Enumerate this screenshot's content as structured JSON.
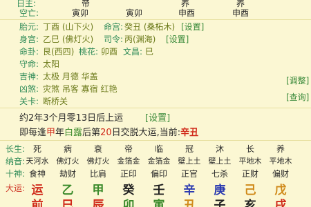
{
  "top_rows": [
    {
      "label": "日主:",
      "cells": [
        "",
        "帝",
        "",
        "",
        "养",
        "",
        "养"
      ]
    },
    {
      "label": "空亡:",
      "cells": [
        "",
        "寅卯",
        "",
        "寅卯",
        "",
        "申酉",
        "",
        "申酉"
      ]
    }
  ],
  "info_rows": [
    {
      "label": "胎元:",
      "value": "丁酉 (山下火)",
      "label2": "命宫:",
      "value2": "癸丑 (桑柘木)",
      "action": "[设置]"
    },
    {
      "label": "身宫:",
      "value": "乙巳 (佛灯火)",
      "label2": "司令:",
      "value2": "丙(渊海)",
      "action": "[设置]"
    },
    {
      "label": "命卦:",
      "value": "艮(西四) ",
      "label2": "桃花:",
      "value2": "卯酉",
      "label3": "文昌:",
      "value3": "巳"
    },
    {
      "label": "守命:",
      "value": "太阳"
    },
    {
      "label": "吉神:",
      "value": "太极 月德 华盖"
    },
    {
      "label": "凶煞:",
      "value": "灾煞 吊客 寡宿 红艳"
    },
    {
      "label": "关卡:",
      "value": "断桥关"
    }
  ],
  "side_actions": {
    "adjust": "[调整]",
    "query": "[查询]"
  },
  "luck_start": {
    "text": "约2年3个月零13日后上运",
    "action": "[设置]"
  },
  "luck_line": {
    "prefix": "即每逢",
    "stem1": "甲",
    "mid1": "年",
    "solar": "白露",
    "mid2": "后第",
    "day": "20",
    "mid3": "日交脱大运,当前:",
    "current": "辛丑"
  },
  "grid": {
    "changsheng": {
      "label": "长生:",
      "cells": [
        "死",
        "病",
        "衰",
        "帝",
        "临",
        "冠",
        "沐",
        "长",
        "养"
      ]
    },
    "nayin": {
      "label": "纳音:",
      "cells": [
        "天河水",
        "佛灯火",
        "佛灯火",
        "金箔金",
        "金箔金",
        "壁上土",
        "壁上土",
        "平地木",
        "平地木"
      ]
    },
    "shishen": {
      "label": "十神:",
      "cells": [
        "食神",
        "劫财",
        "比肩",
        "正印",
        "偏印",
        "正官",
        "七杀",
        "正财",
        "偏财"
      ]
    },
    "dayun": {
      "label": "大运:",
      "cells": [
        "运",
        "乙",
        "甲",
        "癸",
        "壬",
        "辛",
        "庚",
        "己",
        "戊"
      ]
    },
    "bottom": {
      "cells": [
        "前",
        "巳",
        "辰",
        "卯",
        "寅",
        "丑",
        "子",
        "亥",
        "戌"
      ]
    }
  },
  "colors": {
    "background": "#fbf7d3",
    "label_green": "#2e8b57",
    "red": "#d02a1a",
    "orange": "#d08a1a",
    "green": "#3a8a2a",
    "blue": "#2a3ab0"
  }
}
